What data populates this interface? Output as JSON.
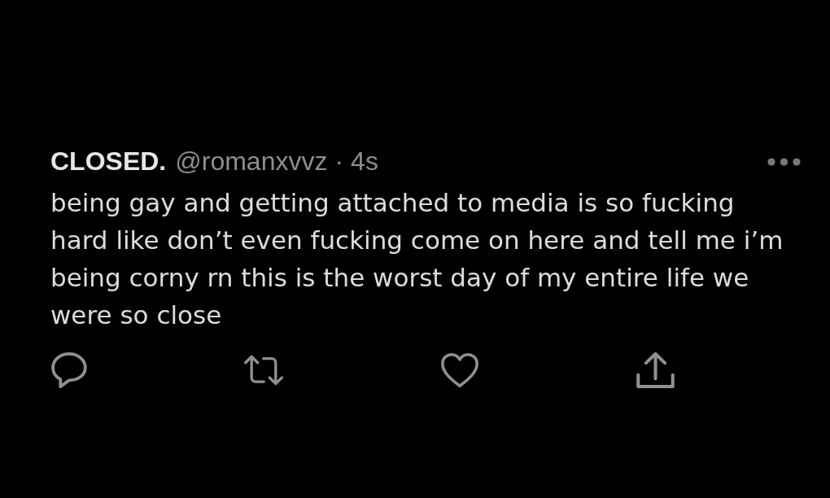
{
  "tweet": {
    "display_name": "CLOSED.",
    "handle": "@romanxvvz",
    "separator": "·",
    "time": "4s",
    "text": "being gay and getting attached to media is so fucking hard like don’t even fucking come on here and tell me i’m being corny rn this is the worst day of my entire life we were so close",
    "liked": false
  }
}
